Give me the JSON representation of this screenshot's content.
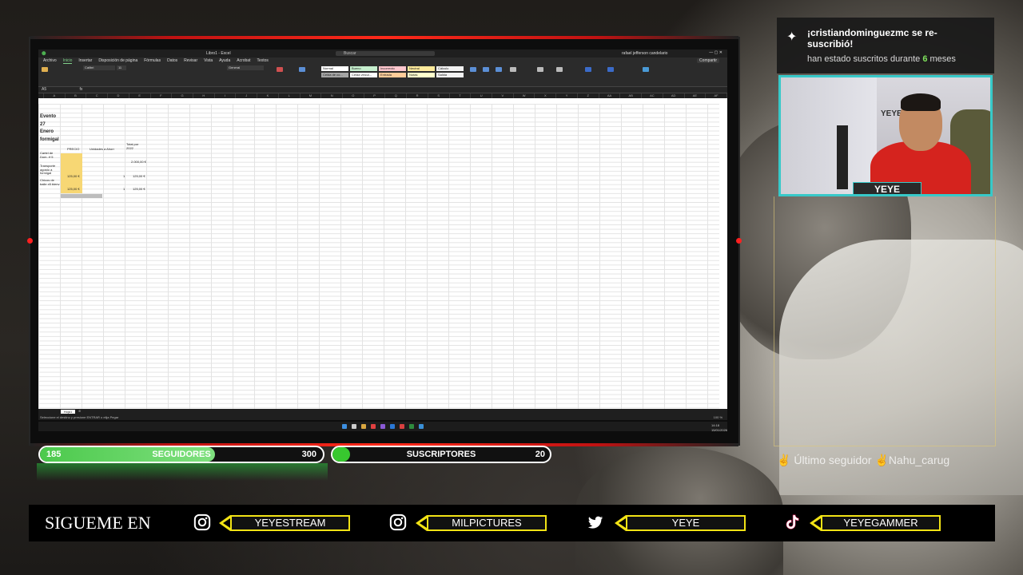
{
  "excel": {
    "window_title": "Libro1 - Excel",
    "search_placeholder": "Buscar",
    "user": "rafael jefferson candelario",
    "menu": [
      "Archivo",
      "Inicio",
      "Insertar",
      "Disposición de página",
      "Fórmulas",
      "Datos",
      "Revisar",
      "Vista",
      "Ayuda",
      "Acrobat",
      "Textos"
    ],
    "active_menu": "Inicio",
    "share_label": "Compartir",
    "font_name": "Calibri",
    "font_size": "11",
    "number_format": "General",
    "styles": [
      {
        "label": "Normal",
        "color": "#ffffff"
      },
      {
        "label": "Bueno",
        "color": "#c6efce"
      },
      {
        "label": "Incorrecto",
        "color": "#ffc7ce"
      },
      {
        "label": "Neutral",
        "color": "#ffeb9c"
      },
      {
        "label": "Cálculo",
        "color": "#f2f2f2"
      },
      {
        "label": "Celda de co...",
        "color": "#a5a5a5"
      },
      {
        "label": "Celda vincul...",
        "color": "#ffffff"
      },
      {
        "label": "Entrada",
        "color": "#ffcc99"
      },
      {
        "label": "Notas",
        "color": "#ffffcc"
      },
      {
        "label": "Salida",
        "color": "#f2f2f2"
      }
    ],
    "name_box": "A5",
    "cells": {
      "title_lines": [
        "Evento",
        "27",
        "Enero",
        "formigal"
      ],
      "header_precio": "PRECIO",
      "header_unidades": "Unidades a Ahorr",
      "header_total": "Total por 2022",
      "rows": [
        {
          "label": "Cartel de Dom. rf 5",
          "total": "2.000,00 €"
        },
        {
          "label": "Transporte agosto a formigal",
          "precio": "125,00 €",
          "unidades": "1",
          "total": "125,00 €"
        },
        {
          "label": "Chicos de baile x5 bienv",
          "precio": "125,00 €",
          "unidades": "1",
          "total": "125,00 €"
        }
      ]
    },
    "sheet_tab": "Hoja1",
    "status_text": "Seleccione el destino y presione ENTRAR o elija Pegar",
    "zoom": "100 %",
    "clock_time": "14:18",
    "clock_date": "15/01/2026"
  },
  "counters": {
    "followers": {
      "current": "185",
      "label": "SEGUIDORES",
      "goal": "300",
      "progress": 0.62,
      "fill_color": "#4cc94c"
    },
    "subscribers": {
      "label": "SUSCRIPTORES",
      "goal": "20",
      "progress": 0.05,
      "fill_color": "#38c82f"
    }
  },
  "social": {
    "heading": "SIGUEME EN",
    "items": [
      {
        "icon": "instagram-icon",
        "handle": "YEYESTREAM"
      },
      {
        "icon": "instagram-icon",
        "handle": "MILPICTURES"
      },
      {
        "icon": "twitter-icon",
        "handle": "YEYE"
      },
      {
        "icon": "tiktok-icon",
        "handle": "YEYEGAMMER"
      }
    ],
    "accent": "#f2e315"
  },
  "alert": {
    "line1": "¡cristiandominguezmc se re-suscribió!",
    "line2_prefix": "han estado suscritos durante",
    "months": "6",
    "line2_suffix": "meses"
  },
  "webcam": {
    "nameplate": "YEYE",
    "wall_text": "YEYE",
    "border_color": "#37c9c9"
  },
  "last_follower": {
    "label": "Último seguidor",
    "name": "Nahu_carug"
  }
}
